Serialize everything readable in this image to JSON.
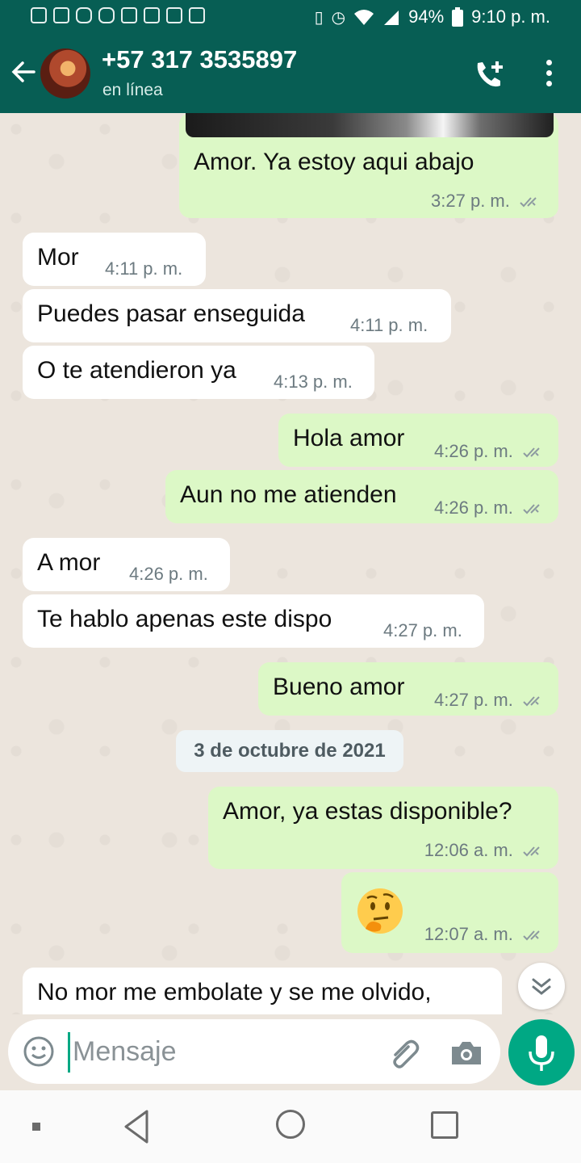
{
  "status_bar": {
    "battery": "94%",
    "time": "9:10 p. m.",
    "left_icons": [
      "screenshot-icon",
      "gallery-icon",
      "instagram-icon",
      "instagram-icon",
      "gmail-icon",
      "app-icon",
      "news-icon",
      "calendar-icon"
    ],
    "right_icons": [
      "vibrate-icon",
      "alarm-icon",
      "wifi-icon",
      "signal-icon",
      "battery-icon"
    ]
  },
  "header": {
    "contact_name": "+57 317 3535897",
    "status": "en línea",
    "back_icon": "arrow-left-icon",
    "call_icon": "add-call-icon",
    "menu_icon": "more-vert-icon"
  },
  "messages": [
    {
      "dir": "out",
      "text": "Amor. Ya estoy aqui abajo",
      "time": "3:27 p. m.",
      "ticks": true
    },
    {
      "dir": "in",
      "text": "Mor",
      "time": "4:11 p. m."
    },
    {
      "dir": "in",
      "text": "Puedes pasar enseguida",
      "time": "4:11 p. m."
    },
    {
      "dir": "in",
      "text": "O te atendieron ya",
      "time": "4:13 p. m."
    },
    {
      "dir": "out",
      "text": "Hola amor",
      "time": "4:26 p. m.",
      "ticks": true
    },
    {
      "dir": "out",
      "text": "Aun no me atienden",
      "time": "4:26 p. m.",
      "ticks": true
    },
    {
      "dir": "in",
      "text": "A mor",
      "time": "4:26 p. m."
    },
    {
      "dir": "in",
      "text": "Te hablo apenas este dispo",
      "time": "4:27 p. m."
    },
    {
      "dir": "out",
      "text": "Bueno amor",
      "time": "4:27 p. m.",
      "ticks": true
    },
    {
      "dir": "out",
      "text": "Amor, ya estas disponible?",
      "time": "12:06 a. m.",
      "ticks": true
    },
    {
      "dir": "out",
      "text": "🤔",
      "time": "12:07 a. m.",
      "ticks": true
    },
    {
      "dir": "in",
      "text": "No mor me embolate y se me olvido,",
      "time": ""
    }
  ],
  "date_separator": "3 de octubre de 2021",
  "composer": {
    "placeholder": "Mensaje",
    "emoji_icon": "emoji-icon",
    "attach_icon": "paperclip-icon",
    "camera_icon": "camera-icon",
    "mic_icon": "mic-icon"
  },
  "scroll_button_icon": "double-chevron-down-icon",
  "nav_bar": {
    "icons": [
      "square-dot-icon",
      "back-triangle-icon",
      "home-circle-icon",
      "recents-square-icon"
    ]
  },
  "colors": {
    "header": "#075e54",
    "outgoing_bubble": "#dcf8c6",
    "incoming_bubble": "#ffffff",
    "accent": "#00a884",
    "chat_background": "#ece5dd"
  }
}
